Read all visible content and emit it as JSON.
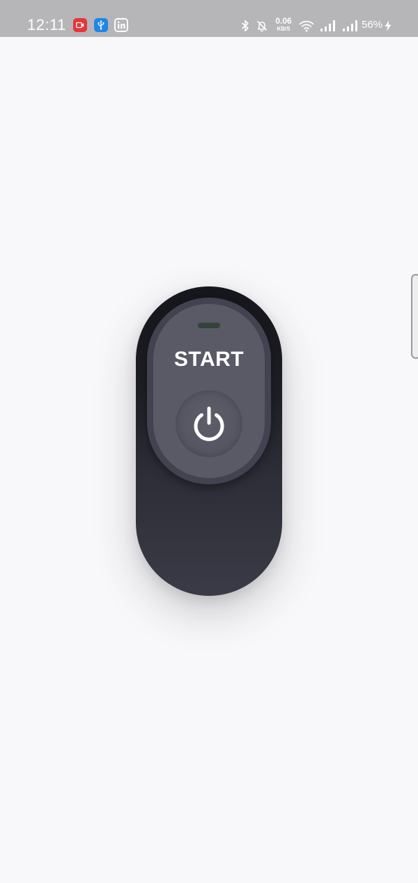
{
  "status_bar": {
    "time": "12:11",
    "notifications": [
      {
        "name": "screen-record-icon",
        "color": "#e8343b"
      },
      {
        "name": "usb-icon",
        "color": "#1d86e8"
      },
      {
        "name": "linkedin-icon",
        "color": "#ffffff"
      }
    ],
    "system_icons": [
      "bluetooth-icon",
      "notifications-muted-icon",
      "wifi-icon",
      "signal-icon",
      "signal-icon",
      "charging-icon"
    ],
    "net_speed_value": "0.06",
    "net_speed_unit": "KB/S",
    "battery": "56%"
  },
  "switch": {
    "label": "START",
    "led_color": "#34433c",
    "button_icon": "power-icon"
  }
}
